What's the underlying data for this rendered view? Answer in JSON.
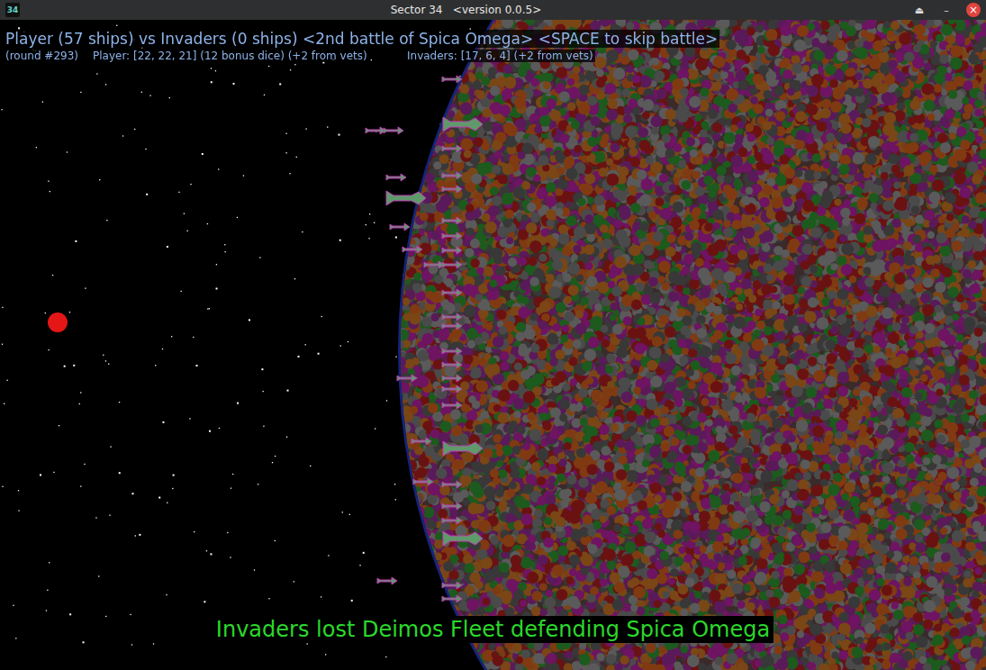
{
  "window": {
    "title": "Sector 34   <version 0.0.5>",
    "icon": "34",
    "controls": [
      "⏏",
      "–",
      "×"
    ]
  },
  "hud": {
    "headline": "Player (57 ships) vs Invaders (0 ships) <2nd battle of Spica Omega> <SPACE to skip battle>",
    "round": "(round #293)",
    "player_dice": "Player: [22, 22, 21] (12 bonus dice) (+2 from vets)",
    "invader_dice": "Invaders: [17, 6, 4] (+2 from vets)"
  },
  "ships": [
    {
      "kind": "fighter"
    },
    {
      "kind": "fighter"
    },
    {
      "kind": "fighter"
    },
    {
      "kind": "cruiser"
    },
    {
      "kind": "fighter"
    },
    {
      "kind": "fighter"
    },
    {
      "kind": "fighter"
    },
    {
      "kind": "fighter"
    },
    {
      "kind": "cruiser"
    },
    {
      "kind": "fighter"
    },
    {
      "kind": "fighter"
    },
    {
      "kind": "fighter"
    },
    {
      "kind": "fighter"
    },
    {
      "kind": "fighter"
    },
    {
      "kind": "fighter"
    },
    {
      "kind": "fighter"
    },
    {
      "kind": "fighter"
    },
    {
      "kind": "fighter"
    },
    {
      "kind": "fighter"
    },
    {
      "kind": "fighter"
    },
    {
      "kind": "fighter"
    },
    {
      "kind": "fighter"
    },
    {
      "kind": "fighter"
    },
    {
      "kind": "fighter"
    },
    {
      "kind": "fighter"
    },
    {
      "kind": "fighter"
    },
    {
      "kind": "cruiser"
    },
    {
      "kind": "fighter"
    },
    {
      "kind": "fighter"
    },
    {
      "kind": "fighter"
    },
    {
      "kind": "fighter"
    },
    {
      "kind": "cruiser"
    },
    {
      "kind": "fighter"
    },
    {
      "kind": "fighter"
    },
    {
      "kind": "fighter"
    }
  ],
  "message": "Invaders lost Deimos Fleet defending Spica Omega"
}
